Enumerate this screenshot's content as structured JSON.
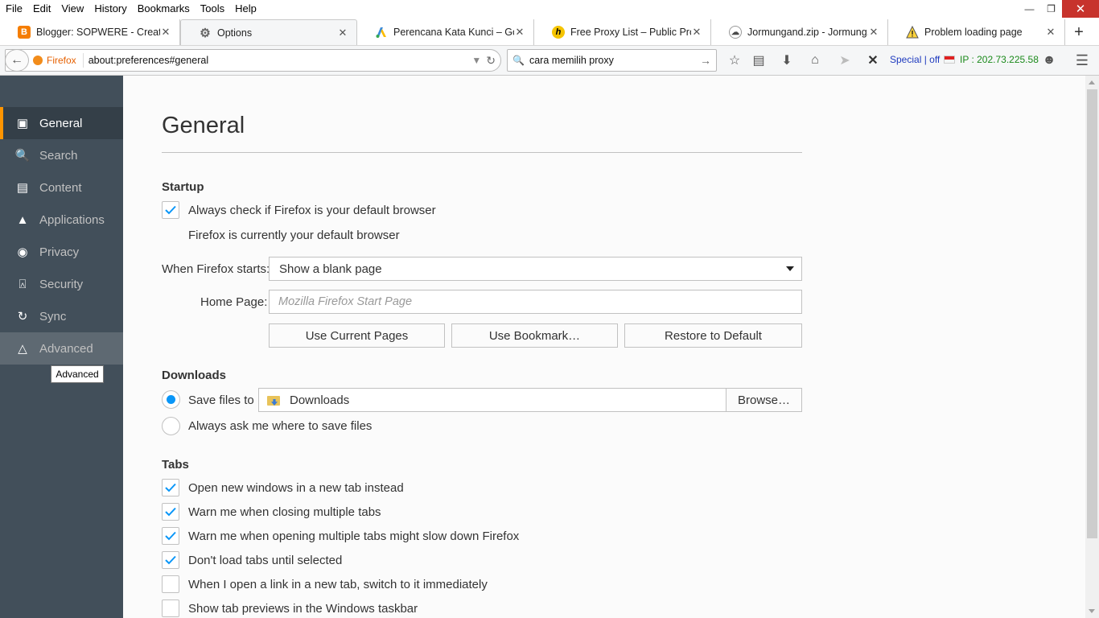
{
  "menubar": {
    "items": [
      "File",
      "Edit",
      "View",
      "History",
      "Bookmarks",
      "Tools",
      "Help"
    ]
  },
  "tabs": [
    {
      "title": "Blogger: SOPWERE - Creat...",
      "favicon": "blogger-icon"
    },
    {
      "title": "Options",
      "favicon": "gear-icon"
    },
    {
      "title": "Perencana Kata Kunci – Go...",
      "favicon": "google-ads-icon"
    },
    {
      "title": "Free Proxy List – Public Pro...",
      "favicon": "h-icon"
    },
    {
      "title": "Jormungand.zip - Jormung...",
      "favicon": "cloud-icon"
    },
    {
      "title": "Problem loading page",
      "favicon": "warning-icon"
    }
  ],
  "navbar": {
    "identity_label": "Firefox",
    "url": "about:preferences#general",
    "search_value": "cara memilih proxy",
    "special_label": "Special | off",
    "ip_label": "IP : 202.73.225.58"
  },
  "sidebar": {
    "categories": [
      {
        "label": "General",
        "icon": "general-icon"
      },
      {
        "label": "Search",
        "icon": "search-icon"
      },
      {
        "label": "Content",
        "icon": "content-icon"
      },
      {
        "label": "Applications",
        "icon": "rocket-icon"
      },
      {
        "label": "Privacy",
        "icon": "mask-icon"
      },
      {
        "label": "Security",
        "icon": "lock-icon"
      },
      {
        "label": "Sync",
        "icon": "sync-icon"
      },
      {
        "label": "Advanced",
        "icon": "wizard-icon"
      }
    ],
    "tooltip": "Advanced"
  },
  "main": {
    "title": "General",
    "startup": {
      "heading": "Startup",
      "default_check_label": "Always check if Firefox is your default browser",
      "default_status": "Firefox is currently your default browser",
      "starts_label": "When Firefox starts:",
      "starts_value": "Show a blank page",
      "home_label": "Home Page:",
      "home_placeholder": "Mozilla Firefox Start Page",
      "btn_current": "Use Current Pages",
      "btn_bookmark": "Use Bookmark…",
      "btn_restore": "Restore to Default"
    },
    "downloads": {
      "heading": "Downloads",
      "save_label": "Save files to",
      "folder": "Downloads",
      "browse": "Browse…",
      "ask_label": "Always ask me where to save files"
    },
    "tabs_section": {
      "heading": "Tabs",
      "options": [
        {
          "label": "Open new windows in a new tab instead",
          "checked": true
        },
        {
          "label": "Warn me when closing multiple tabs",
          "checked": true
        },
        {
          "label": "Warn me when opening multiple tabs might slow down Firefox",
          "checked": true
        },
        {
          "label": "Don't load tabs until selected",
          "checked": true
        },
        {
          "label": "When I open a link in a new tab, switch to it immediately",
          "checked": false
        },
        {
          "label": "Show tab previews in the Windows taskbar",
          "checked": false
        }
      ]
    }
  },
  "colors": {
    "sidebar_bg": "#424f5a",
    "selected_accent": "#ff9500",
    "check_blue": "#0996f8"
  }
}
